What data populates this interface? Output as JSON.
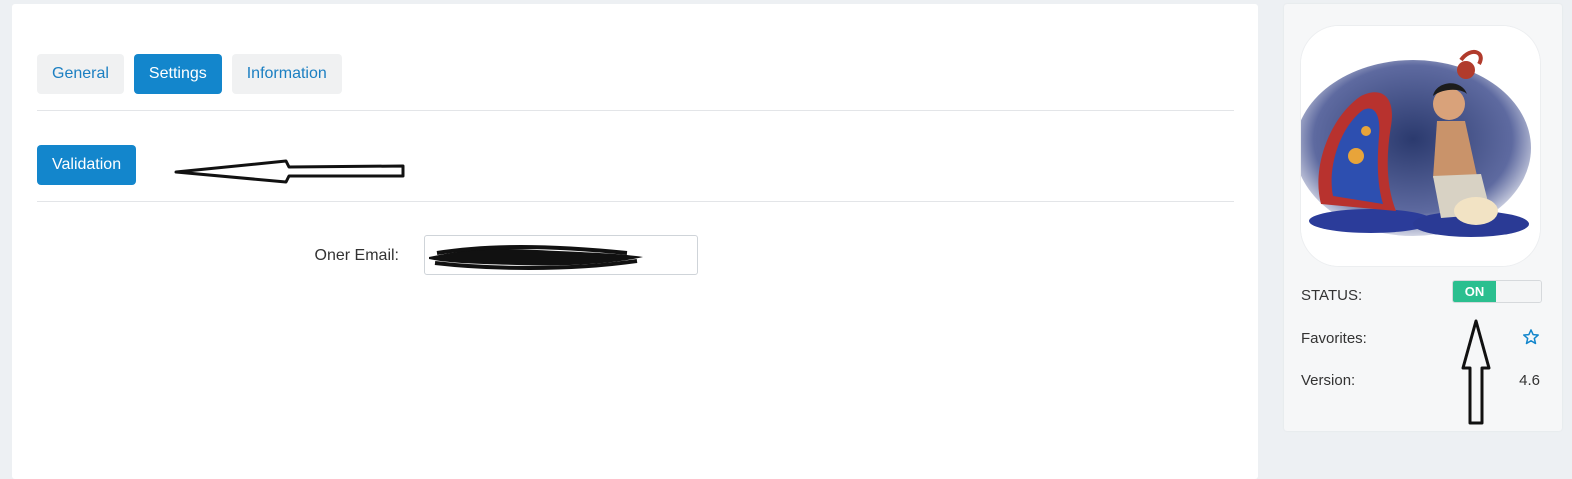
{
  "tabs": [
    {
      "label": "General",
      "active": false
    },
    {
      "label": "Settings",
      "active": true
    },
    {
      "label": "Information",
      "active": false
    }
  ],
  "settings": {
    "validation_label": "Validation",
    "email_label": "Oner Email:",
    "email_value_redacted": true
  },
  "sidebar": {
    "image_icon": "aladdin-magic-carpet-figurine",
    "status_label": "STATUS:",
    "status_toggle_text": "ON",
    "status_on": true,
    "favorites_label": "Favorites:",
    "favorites_icon": "star-outline-icon",
    "version_label": "Version:",
    "version_value": "4.6"
  },
  "colors": {
    "primary": "#1386cc",
    "toggle_on": "#2bbf8f",
    "star": "#1386cc"
  }
}
